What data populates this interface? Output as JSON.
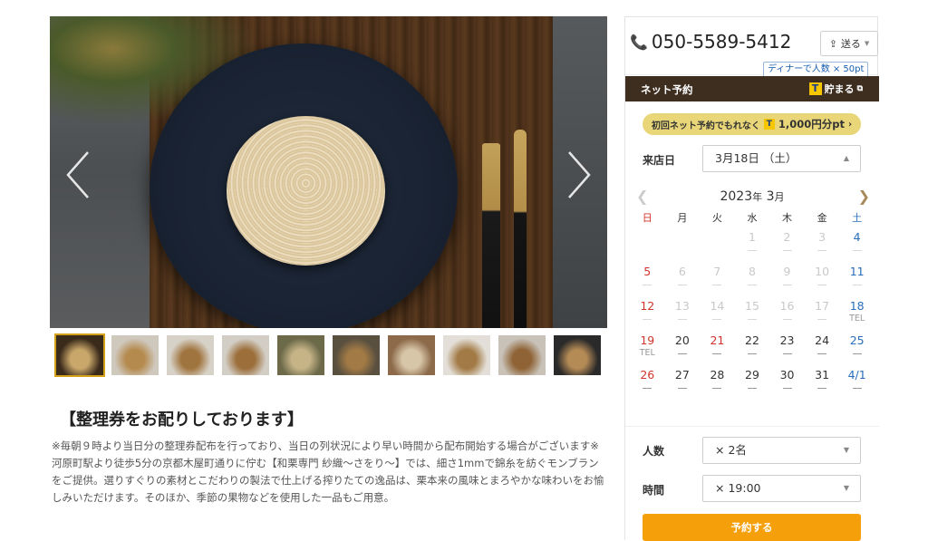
{
  "gallery": {
    "thumb_count": 10,
    "active_index": 0
  },
  "article": {
    "title": "【整理券をお配りしております】",
    "paragraph1": "※毎朝９時より当日分の整理券配布を行っており、当日の列状況により早い時間から配布開始する場合がございます※",
    "paragraph2": "河原町駅より徒歩5分の京都木屋町通りに佇む【和栗専門 紗織～さをり～】では、細さ1mmで錦糸を紡ぐモンブランをご提供。選りすぐりの素材とこだわりの製法で仕上げる搾りたての逸品は、栗本来の風味とまろやかな味わいをお愉しみいただけます。そのほか、季節の果物などを使用した一品もご用意。"
  },
  "sidebar": {
    "phone": "050-5589-5412",
    "send_label": "送る",
    "tpoint_tip": "ディナーで人数 × 50pt",
    "net_reserve_label": "ネット予約",
    "tpoint_label": "貯まる",
    "promo_text": "初回ネット予約でもれなく",
    "promo_points": "1,000円分pt",
    "date_label": "来店日",
    "date_value": "3月18日 （土）",
    "calendar": {
      "year": "2023",
      "year_unit": "年",
      "month": "3",
      "month_unit": "月",
      "weekdays": [
        "日",
        "月",
        "火",
        "水",
        "木",
        "金",
        "土"
      ],
      "weeks": [
        [
          {
            "d": ""
          },
          {
            "d": ""
          },
          {
            "d": ""
          },
          {
            "d": "1",
            "past": true
          },
          {
            "d": "2",
            "past": true
          },
          {
            "d": "3",
            "past": true
          },
          {
            "d": "4",
            "past": true
          }
        ],
        [
          {
            "d": "5",
            "past": true
          },
          {
            "d": "6",
            "past": true
          },
          {
            "d": "7",
            "past": true
          },
          {
            "d": "8",
            "past": true
          },
          {
            "d": "9",
            "past": true
          },
          {
            "d": "10",
            "past": true
          },
          {
            "d": "11",
            "past": true
          }
        ],
        [
          {
            "d": "12",
            "past": true
          },
          {
            "d": "13",
            "past": true
          },
          {
            "d": "14",
            "past": true
          },
          {
            "d": "15",
            "past": true
          },
          {
            "d": "16",
            "past": true
          },
          {
            "d": "17",
            "past": true
          },
          {
            "d": "18",
            "tel": "TEL"
          }
        ],
        [
          {
            "d": "19",
            "tel": "TEL"
          },
          {
            "d": "20"
          },
          {
            "d": "21",
            "holiday": true
          },
          {
            "d": "22"
          },
          {
            "d": "23"
          },
          {
            "d": "24"
          },
          {
            "d": "25"
          }
        ],
        [
          {
            "d": "26"
          },
          {
            "d": "27"
          },
          {
            "d": "28"
          },
          {
            "d": "29"
          },
          {
            "d": "30"
          },
          {
            "d": "31"
          },
          {
            "d": "4/1"
          }
        ]
      ]
    },
    "people_label": "人数",
    "people_value": "× 2名",
    "time_label": "時間",
    "time_value": "× 19:00",
    "reserve_button": "予約する"
  },
  "colors": {
    "header_bg": "#3d2e20",
    "promo_bg": "#e8d678",
    "reserve_btn": "#f59f0a",
    "sunday": "#d0342c",
    "saturday": "#2a6ebb",
    "accent": "#a88a5a"
  }
}
